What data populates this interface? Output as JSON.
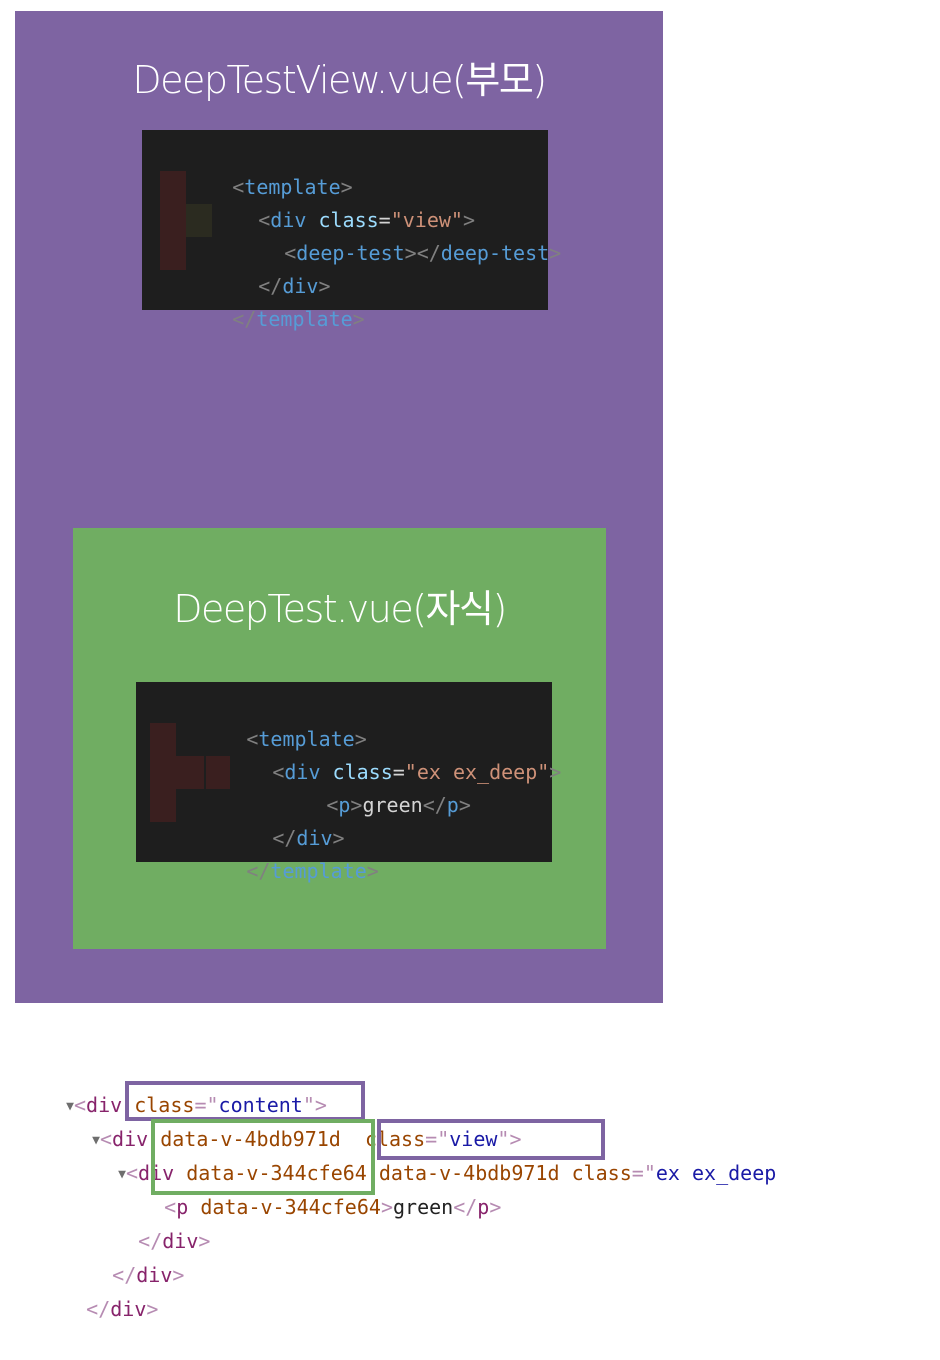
{
  "parent": {
    "title": "DeepTestView.vue(부모)",
    "code": [
      [
        "<",
        "template",
        ">"
      ],
      [
        "<",
        "div",
        " class=",
        "\"view\"",
        ">"
      ],
      [
        "<",
        "deep-test",
        "></",
        "deep-test",
        ">"
      ],
      [
        "</",
        "div",
        ">"
      ],
      [
        "</",
        "template",
        ">"
      ]
    ]
  },
  "child": {
    "title": "DeepTest.vue(자식)",
    "code": [
      [
        "<",
        "template",
        ">"
      ],
      [
        "<",
        "div",
        " class=",
        "\"ex ex_deep\"",
        ">"
      ],
      [
        "<",
        "p",
        ">",
        "green",
        "</",
        "p",
        ">"
      ],
      [
        "</",
        "div",
        ">"
      ],
      [
        "</",
        "template",
        ">"
      ]
    ]
  },
  "devtools": {
    "rows": [
      {
        "tag": "div",
        "attr1": "class",
        "val1": "content"
      },
      {
        "tag": "div",
        "scope1": "data-v-4bdb971d",
        "attr1": "class",
        "val1": "view"
      },
      {
        "tag": "div",
        "scope1": "data-v-344cfe64",
        "scope2": "data-v-4bdb971d",
        "attr1": "class",
        "val1": "ex ex_deep"
      },
      {
        "tag": "p",
        "scope1": "data-v-344cfe64",
        "text": "green",
        "close": "p"
      },
      {
        "close": "div"
      },
      {
        "close": "div"
      },
      {
        "close": "div"
      }
    ]
  },
  "colors": {
    "parent": "#7e64a2",
    "child": "#70ad62",
    "code_bg": "#1e1e1e"
  }
}
